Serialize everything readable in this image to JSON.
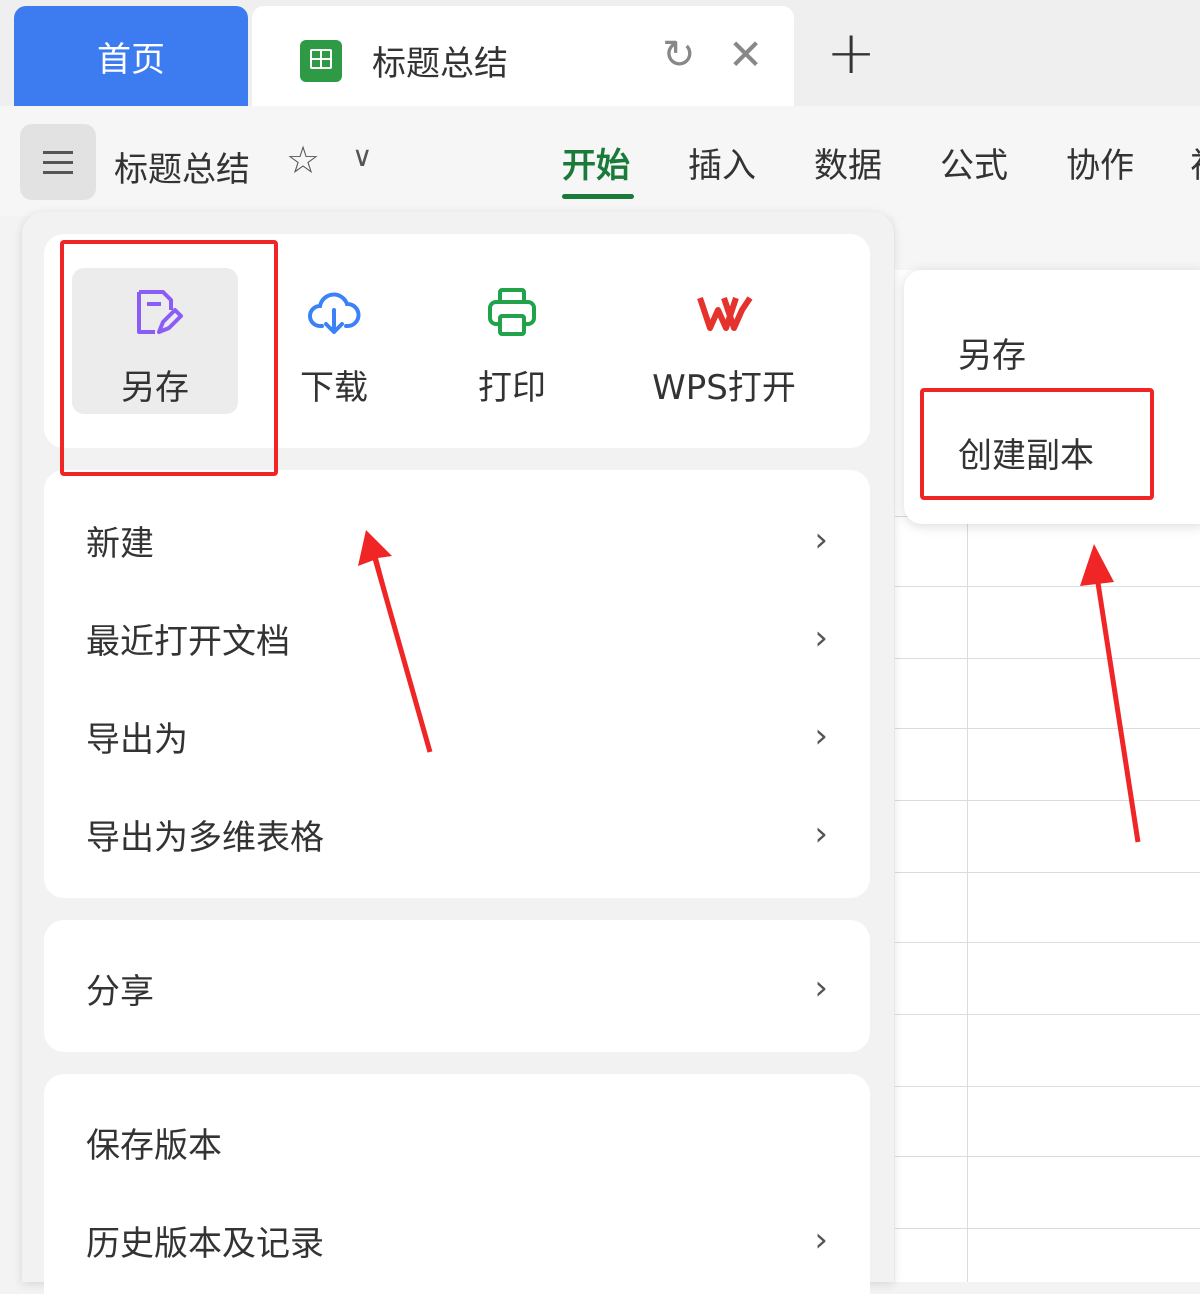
{
  "tabs": {
    "home_label": "首页",
    "doc_label": "标题总结",
    "refresh_icon": "refresh-icon",
    "close_icon": "close-icon",
    "new_icon": "plus-icon"
  },
  "toolbar": {
    "doc_title": "标题总结",
    "ribbon_tabs": [
      "开始",
      "插入",
      "数据",
      "公式",
      "协作",
      "视"
    ],
    "active_tab": "开始"
  },
  "menu": {
    "quick_actions": [
      {
        "label": "另存",
        "icon": "save-as-icon"
      },
      {
        "label": "下载",
        "icon": "cloud-download-icon"
      },
      {
        "label": "打印",
        "icon": "printer-icon"
      },
      {
        "label": "WPS打开",
        "icon": "wps-logo-icon"
      }
    ],
    "group1": [
      "新建",
      "最近打开文档",
      "导出为",
      "导出为多维表格"
    ],
    "group2": [
      "分享"
    ],
    "group3": [
      "保存版本",
      "历史版本及记录"
    ]
  },
  "submenu": {
    "items": [
      "另存",
      "创建副本"
    ]
  },
  "colors": {
    "accent_blue": "#3d7cf0",
    "active_green": "#1a7a3a",
    "annotation_red": "#f02525",
    "save_icon_purple": "#8b5cf6",
    "download_icon_blue": "#3b82f6",
    "print_icon_green": "#22a24a",
    "wps_red": "#e5322d"
  }
}
